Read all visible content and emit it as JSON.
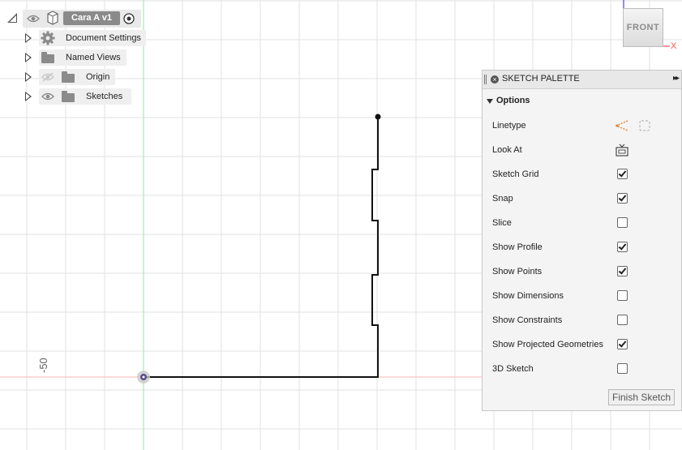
{
  "browser": {
    "component_name": "Cara A v1",
    "items": [
      {
        "label": "Document Settings"
      },
      {
        "label": "Named Views"
      },
      {
        "label": "Origin"
      },
      {
        "label": "Sketches"
      }
    ]
  },
  "viewcube": {
    "face": "FRONT",
    "axis_x": "X"
  },
  "canvas": {
    "axis_value": "-50",
    "grid_color": "#e2e2e2",
    "origin_axis_color": "#ffb3b3",
    "vertical_axis_color": "#9fdf9f"
  },
  "palette": {
    "title": "SKETCH PALETTE",
    "expand": "▸▸",
    "section": "Options",
    "rows": [
      {
        "label": "Linetype",
        "kind": "icons"
      },
      {
        "label": "Look At",
        "kind": "icon"
      },
      {
        "label": "Sketch Grid",
        "checked": true
      },
      {
        "label": "Snap",
        "checked": true
      },
      {
        "label": "Slice",
        "checked": false
      },
      {
        "label": "Show Profile",
        "checked": true
      },
      {
        "label": "Show Points",
        "checked": true
      },
      {
        "label": "Show Dimensions",
        "checked": false
      },
      {
        "label": "Show Constraints",
        "checked": false
      },
      {
        "label": "Show Projected Geometries",
        "checked": true
      },
      {
        "label": "3D Sketch",
        "checked": false
      }
    ],
    "finish_label": "Finish Sketch"
  },
  "annotation": {
    "color": "#e01010",
    "shape": "circle-highlight"
  }
}
